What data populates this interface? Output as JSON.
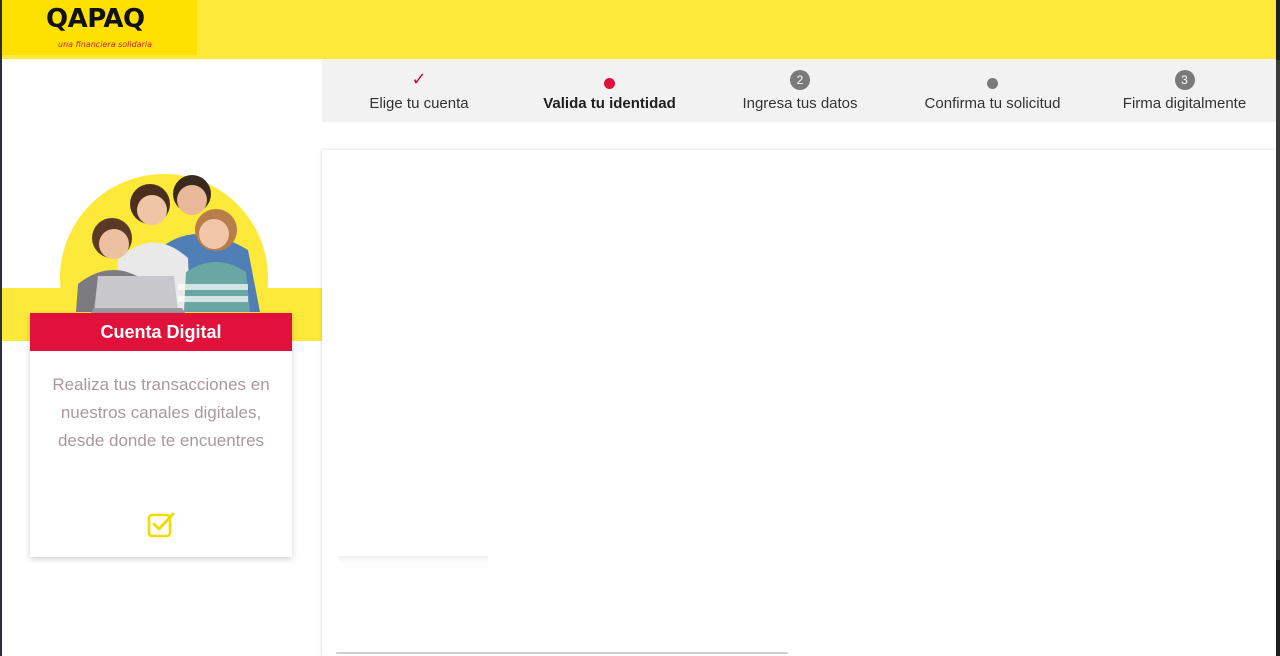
{
  "brand": {
    "name": "QAPAQ",
    "tagline": "una financiera solidaria",
    "colors": {
      "yellow": "#fde93a",
      "red": "#e0113a"
    }
  },
  "stepper": {
    "steps": [
      {
        "label": "Elige tu cuenta",
        "state": "done",
        "marker": "check-icon"
      },
      {
        "label": "Valida tu identidad",
        "state": "active",
        "marker": "dot"
      },
      {
        "label": "Ingresa tus datos",
        "state": "pending",
        "marker": "2"
      },
      {
        "label": "Confirma tu solicitud",
        "state": "pending",
        "marker": "dot"
      },
      {
        "label": "Firma digitalmente",
        "state": "pending",
        "marker": "3"
      }
    ]
  },
  "product_card": {
    "title": "Cuenta Digital",
    "description": "Realiza tus transacciones en nuestros canales digitales, desde donde te encuentres",
    "icon": "checkbox-checked-icon"
  }
}
